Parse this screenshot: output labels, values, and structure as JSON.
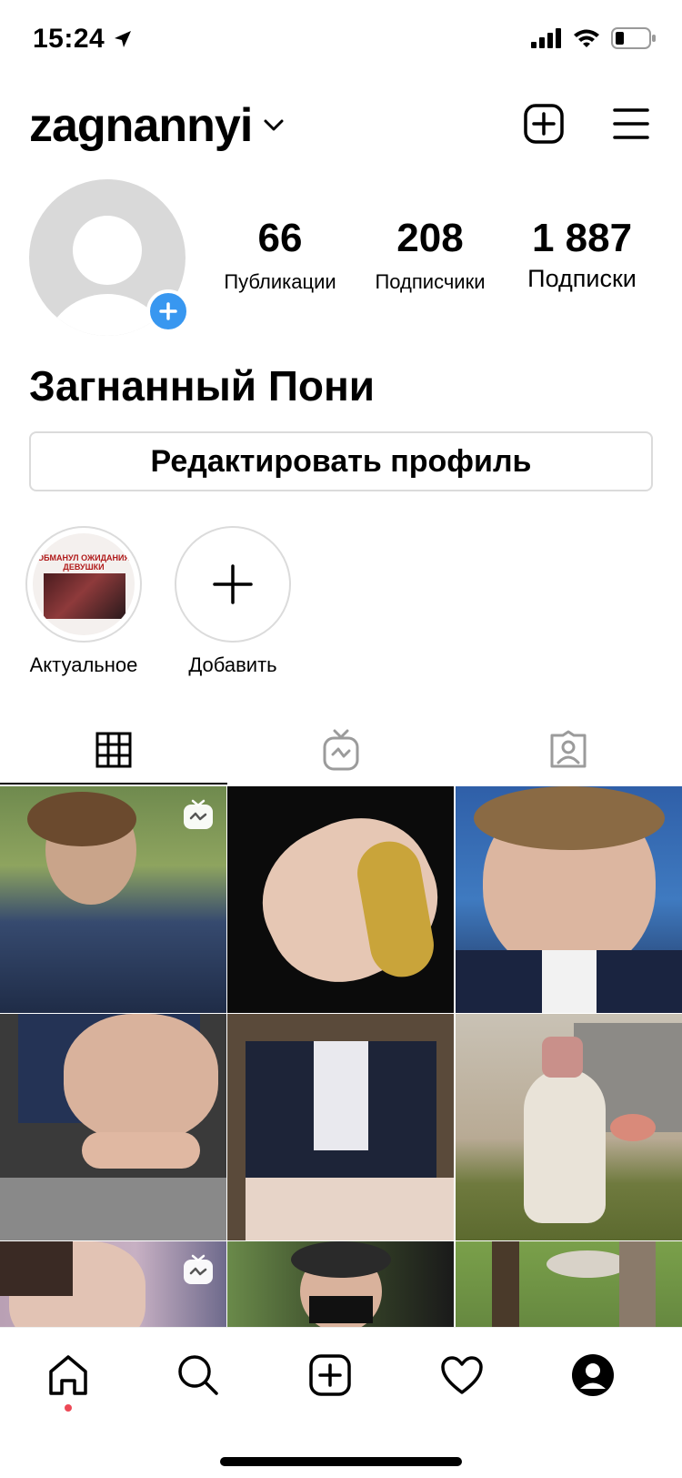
{
  "status_bar": {
    "time": "15:24",
    "icons": [
      "location-arrow-icon",
      "cellular-signal-icon",
      "wifi-icon",
      "battery-icon"
    ]
  },
  "header": {
    "username": "zagnannyi",
    "icons": [
      "chevron-down-icon",
      "new-post-icon",
      "menu-icon"
    ]
  },
  "profile": {
    "stats": [
      {
        "value": "66",
        "label": "Публикации"
      },
      {
        "value": "208",
        "label": "Подписчики"
      },
      {
        "value": "1 887",
        "label": "Подписки"
      }
    ],
    "full_name": "Загнанный Пони",
    "edit_button": "Редактировать профиль"
  },
  "highlights": [
    {
      "label": "Актуальное",
      "cover_text": "ОБМАНУЛ ОЖИДАНИЯ ДЕВУШКИ"
    },
    {
      "label": "Добавить"
    }
  ],
  "tabs": [
    {
      "icon": "grid-icon",
      "active": true
    },
    {
      "icon": "igtv-icon",
      "active": false
    },
    {
      "icon": "tagged-icon",
      "active": false
    }
  ],
  "bottom_nav": [
    {
      "icon": "home-icon",
      "active": true
    },
    {
      "icon": "search-icon"
    },
    {
      "icon": "new-post-icon"
    },
    {
      "icon": "activity-heart-icon"
    },
    {
      "icon": "profile-icon"
    }
  ],
  "colors": {
    "accent_blue": "#3897f0",
    "border": "#dbdbdb",
    "notification_dot": "#ed4956"
  }
}
